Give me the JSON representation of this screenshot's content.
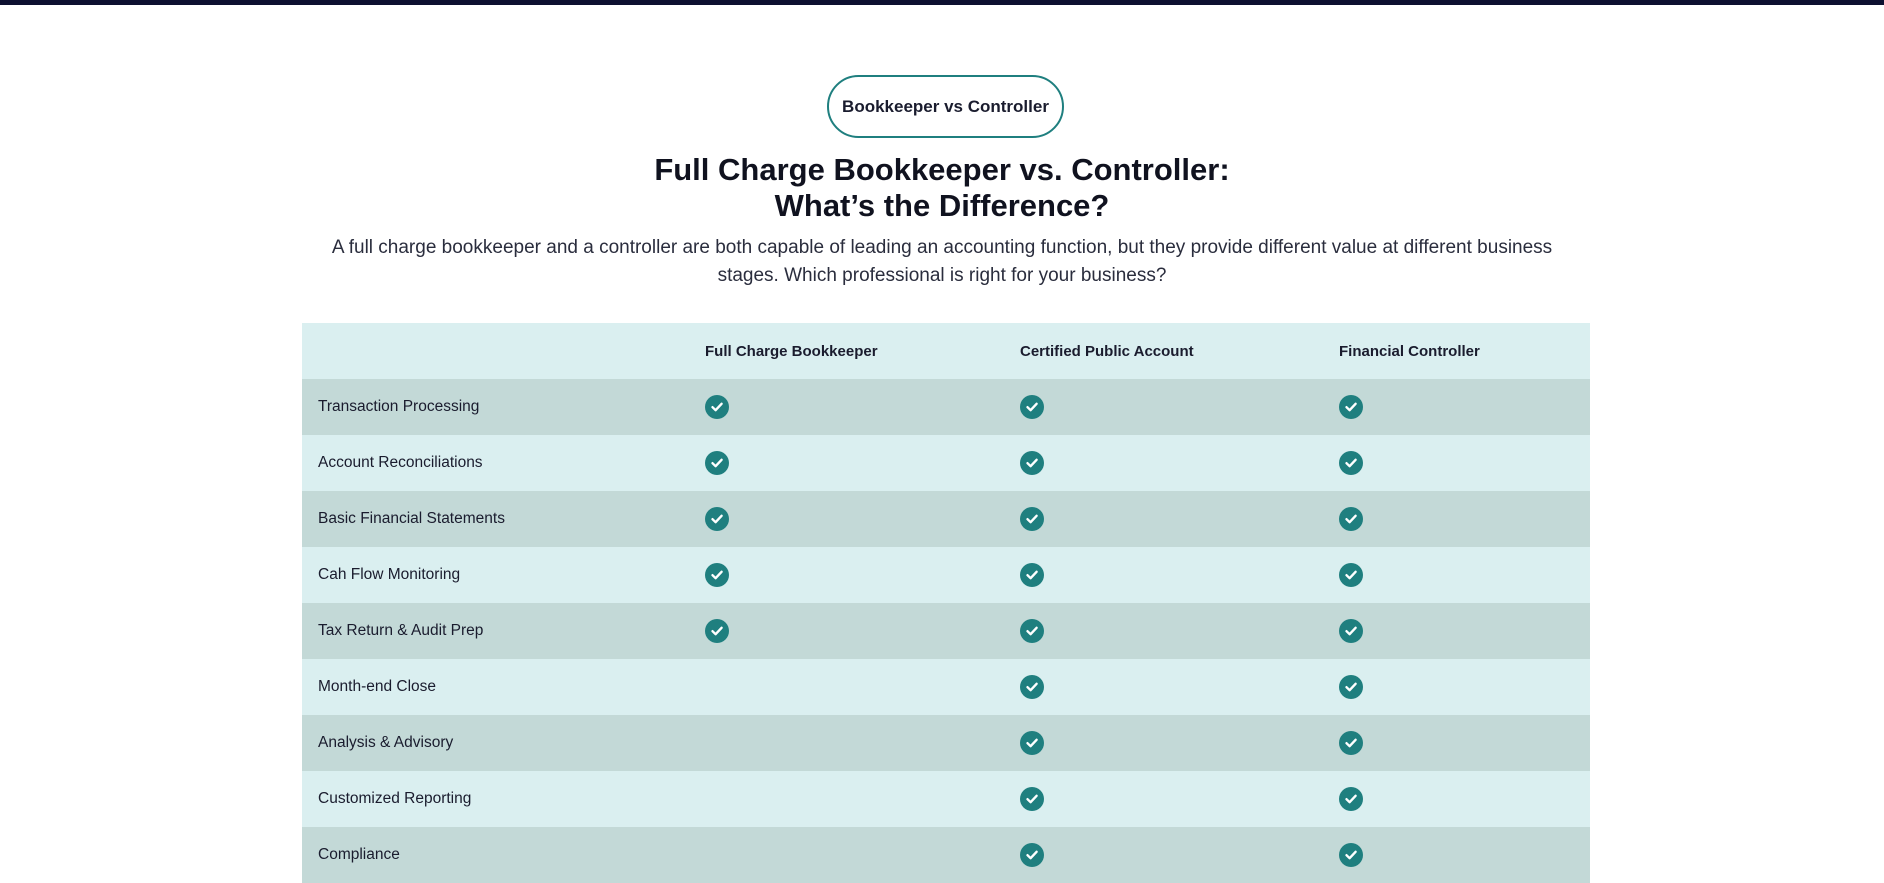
{
  "badge": {
    "label": "Bookkeeper vs Controller"
  },
  "heading": {
    "line1": "Full Charge Bookkeeper vs. Controller:",
    "line2": "What’s the Difference?"
  },
  "subtitle": "A full charge bookkeeper and a controller are both capable of leading an accounting function, but they provide different value at different business stages. Which professional is right for your business?",
  "table": {
    "columns": [
      "",
      "Full Charge Bookkeeper",
      "Certified Public Account",
      "Financial Controller"
    ],
    "rows": [
      {
        "label": "Transaction Processing",
        "checks": [
          true,
          true,
          true
        ]
      },
      {
        "label": "Account Reconciliations",
        "checks": [
          true,
          true,
          true
        ]
      },
      {
        "label": "Basic Financial Statements",
        "checks": [
          true,
          true,
          true
        ]
      },
      {
        "label": "Cah Flow Monitoring",
        "checks": [
          true,
          true,
          true
        ]
      },
      {
        "label": "Tax Return & Audit Prep",
        "checks": [
          true,
          true,
          true
        ]
      },
      {
        "label": "Month-end Close",
        "checks": [
          false,
          true,
          true
        ]
      },
      {
        "label": "Analysis & Advisory",
        "checks": [
          false,
          true,
          true
        ]
      },
      {
        "label": "Customized Reporting",
        "checks": [
          false,
          true,
          true
        ]
      },
      {
        "label": "Compliance",
        "checks": [
          false,
          true,
          true
        ]
      }
    ]
  },
  "colors": {
    "accent": "#1f7f7f",
    "row_light": "#daeff0",
    "row_dark": "#c3d9d7",
    "top_bar": "#0d1030"
  },
  "icons": {
    "check": "check-circle-icon"
  }
}
